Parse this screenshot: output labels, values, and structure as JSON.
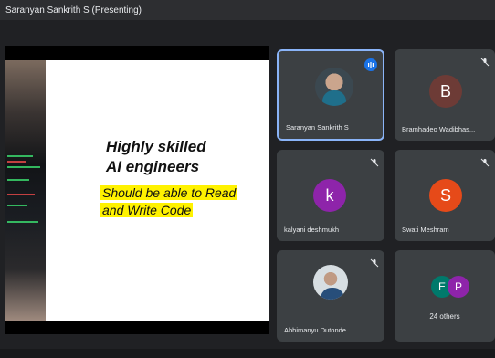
{
  "window": {
    "title": "Saranyan Sankrith S (Presenting)"
  },
  "presentation": {
    "slide_title_line1": "Highly skilled",
    "slide_title_line2": "AI engineers",
    "highlight_line1": "Should be able to Read",
    "highlight_line2": "and  Write Code"
  },
  "participants": {
    "items": [
      {
        "name": "Saranyan Sankrith S",
        "type": "photo",
        "active": true,
        "speaking": true
      },
      {
        "name": "Bramhadeo Wadibhas...",
        "initial": "B",
        "avatar_color": "#6d3b36"
      },
      {
        "name": "kalyani deshmukh",
        "initial": "k",
        "avatar_color": "#8e24aa"
      },
      {
        "name": "Swati Meshram",
        "initial": "S",
        "avatar_color": "#e64a19"
      },
      {
        "name": "Abhimanyu Dutonde",
        "type": "photo"
      },
      {
        "name": "24 others",
        "stack": [
          {
            "initial": "E",
            "color": "#00796b"
          },
          {
            "initial": "P",
            "color": "#8e24aa"
          }
        ]
      }
    ]
  },
  "colors": {
    "tile_bg": "#3c4043",
    "active_border": "#8ab4f8",
    "highlight": "#fff200"
  }
}
